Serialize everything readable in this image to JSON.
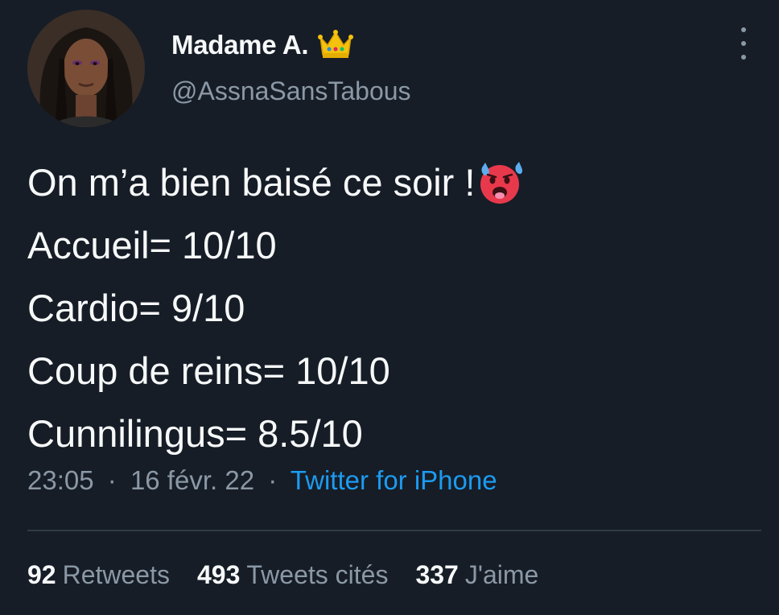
{
  "user": {
    "display_name": "Madame A.",
    "handle": "@AssnaSansTabous",
    "badge_icon": "crown-emoji",
    "avatar": "profile-photo"
  },
  "tweet": {
    "lines": [
      "On m’a bien baisé ce soir !",
      "Accueil= 10/10",
      "Cardio= 9/10",
      "Coup de reins= 10/10",
      "Cunnilingus= 8.5/10"
    ],
    "emoji": "hot-face-sweat-emoji"
  },
  "meta": {
    "time": "23:05",
    "date": "16 févr. 22",
    "separator": "·",
    "source": "Twitter for iPhone"
  },
  "stats": {
    "retweets_count": "92",
    "retweets_label": "Retweets",
    "quotes_count": "493",
    "quotes_label": "Tweets cités",
    "likes_count": "337",
    "likes_label": "J'aime"
  },
  "colors": {
    "background": "#161d27",
    "text": "#f7f9f9",
    "secondary_text": "#8b98a5",
    "link": "#1d9bf0",
    "divider": "#2f3a45"
  }
}
